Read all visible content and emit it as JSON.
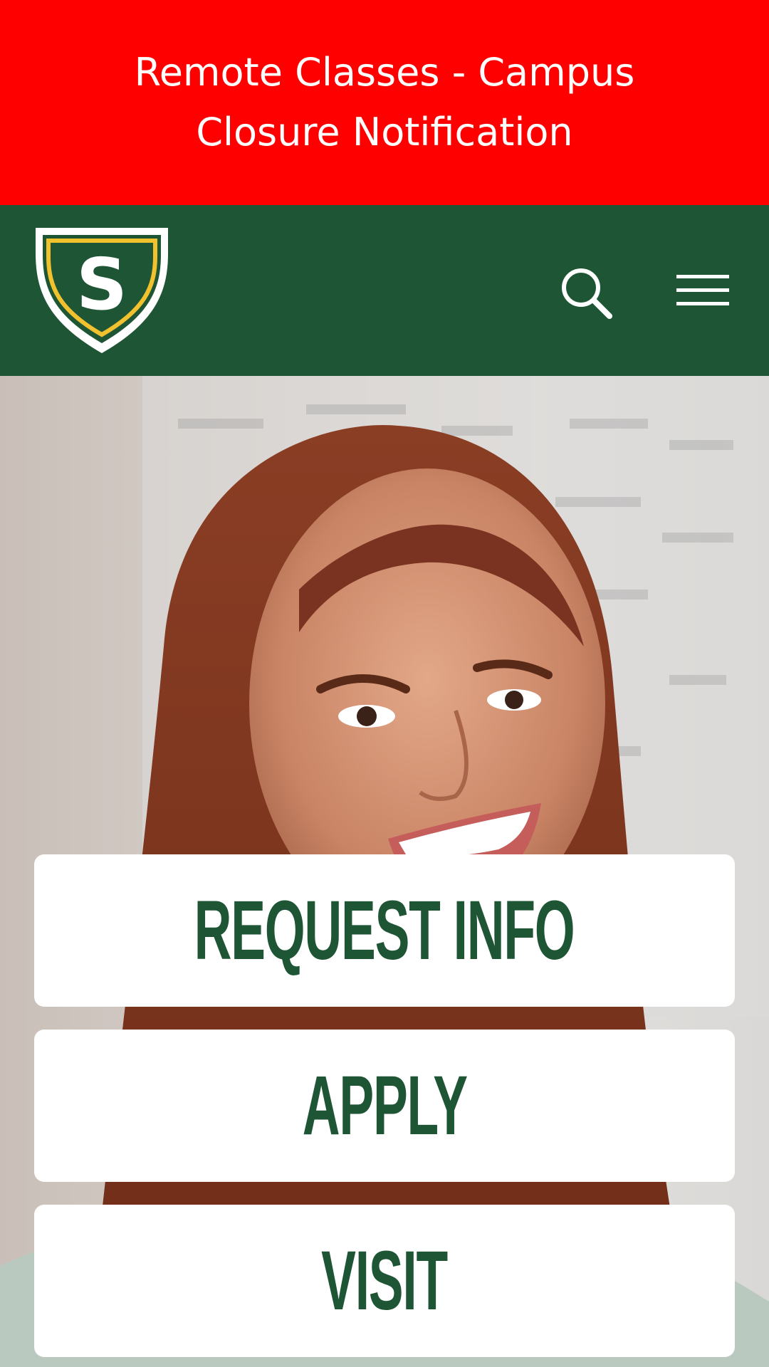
{
  "alert": {
    "text": "Remote Classes - Campus Closure Notification",
    "background": "#ff0000",
    "text_color": "#ffffff"
  },
  "header": {
    "background": "#1d5535",
    "logo_letter": "S",
    "logo_icon": "shield-logo-icon",
    "search_icon": "search-icon",
    "menu_icon": "hamburger-menu-icon"
  },
  "hero": {
    "image": "smiling-student-photo"
  },
  "cta": {
    "request_info": "REQUEST INFO",
    "apply": "APPLY",
    "visit": "VISIT",
    "text_color": "#1d5535",
    "background": "#ffffff"
  }
}
